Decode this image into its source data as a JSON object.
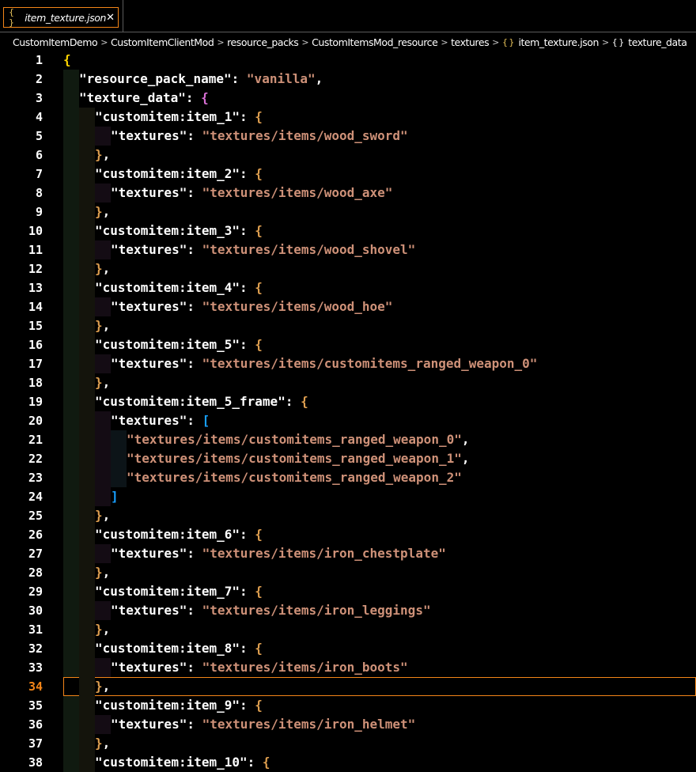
{
  "tab": {
    "icon": "{ }",
    "label": "item_texture.json",
    "close": "✕"
  },
  "breadcrumb": [
    "CustomItemDemo",
    "CustomItemClientMod",
    "resource_packs",
    "CustomItemsMod_resource",
    "textures",
    "item_texture.json",
    "texture_data"
  ],
  "editor": {
    "current_line": 34,
    "lines": [
      {
        "n": "1"
      },
      {
        "n": "2"
      },
      {
        "n": "3"
      },
      {
        "n": "4"
      },
      {
        "n": "5"
      },
      {
        "n": "6"
      },
      {
        "n": "7"
      },
      {
        "n": "8"
      },
      {
        "n": "9"
      },
      {
        "n": "10"
      },
      {
        "n": "11"
      },
      {
        "n": "12"
      },
      {
        "n": "13"
      },
      {
        "n": "14"
      },
      {
        "n": "15"
      },
      {
        "n": "16"
      },
      {
        "n": "17"
      },
      {
        "n": "18"
      },
      {
        "n": "19"
      },
      {
        "n": "20"
      },
      {
        "n": "21"
      },
      {
        "n": "22"
      },
      {
        "n": "23"
      },
      {
        "n": "24"
      },
      {
        "n": "25"
      },
      {
        "n": "26"
      },
      {
        "n": "27"
      },
      {
        "n": "28"
      },
      {
        "n": "29"
      },
      {
        "n": "30"
      },
      {
        "n": "31"
      },
      {
        "n": "32"
      },
      {
        "n": "33"
      },
      {
        "n": "34"
      },
      {
        "n": "35"
      },
      {
        "n": "36"
      },
      {
        "n": "37"
      },
      {
        "n": "38"
      }
    ],
    "tokens": {
      "resource_pack_name_key": "\"resource_pack_name\"",
      "resource_pack_name_val": "\"vanilla\"",
      "texture_data_key": "\"texture_data\"",
      "textures_key": "\"textures\"",
      "items": [
        {
          "key": "\"customitem:item_1\"",
          "val": "\"textures/items/wood_sword\""
        },
        {
          "key": "\"customitem:item_2\"",
          "val": "\"textures/items/wood_axe\""
        },
        {
          "key": "\"customitem:item_3\"",
          "val": "\"textures/items/wood_shovel\""
        },
        {
          "key": "\"customitem:item_4\"",
          "val": "\"textures/items/wood_hoe\""
        },
        {
          "key": "\"customitem:item_5\"",
          "val": "\"textures/items/customitems_ranged_weapon_0\""
        },
        {
          "key": "\"customitem:item_5_frame\"",
          "vals": [
            "\"textures/items/customitems_ranged_weapon_0\"",
            "\"textures/items/customitems_ranged_weapon_1\"",
            "\"textures/items/customitems_ranged_weapon_2\""
          ]
        },
        {
          "key": "\"customitem:item_6\"",
          "val": "\"textures/items/iron_chestplate\""
        },
        {
          "key": "\"customitem:item_7\"",
          "val": "\"textures/items/iron_leggings\""
        },
        {
          "key": "\"customitem:item_8\"",
          "val": "\"textures/items/iron_boots\""
        },
        {
          "key": "\"customitem:item_9\"",
          "val": "\"textures/items/iron_helmet\""
        },
        {
          "key": "\"customitem:item_10\""
        }
      ]
    }
  },
  "colors": {
    "string": "#ce9178",
    "key": "#ffffff",
    "cursor_line": "#f38518",
    "bracket_gold": "#ffd700",
    "bracket_blue": "#179fff"
  }
}
